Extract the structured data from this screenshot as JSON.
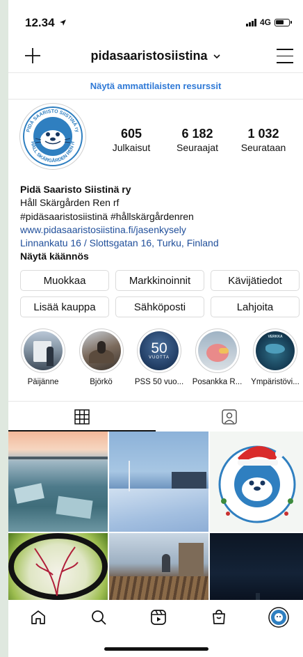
{
  "status": {
    "time": "12.34",
    "network": "4G"
  },
  "header": {
    "username": "pidasaaristosiistina",
    "pro_link": "Näytä ammattilaisten resurssit"
  },
  "profile": {
    "avatar_logo_text_top": "PIDÄ SAARISTO SIISTINÄ ry",
    "avatar_logo_text_bottom": "HÅLL SKÄRGÅRDEN REN rf",
    "stats": [
      {
        "value": "605",
        "label": "Julkaisut"
      },
      {
        "value": "6 182",
        "label": "Seuraajat"
      },
      {
        "value": "1 032",
        "label": "Seurataan"
      }
    ],
    "name": "Pidä Saaristo Siistinä ry",
    "bio_lines": [
      "Håll Skärgården Ren rf",
      "#pidäsaaristosiistinä #hållskärgårdenren"
    ],
    "website": "www.pidasaaristosiistina.fi/jasenkysely",
    "address": "Linnankatu 16 / Slottsgatan 16, Turku, Finland",
    "translate": "Näytä käännös"
  },
  "buttons": [
    "Muokkaa",
    "Markkinoinnit",
    "Kävijätiedot",
    "Lisää kauppa",
    "Sähköposti",
    "Lahjoita"
  ],
  "highlights": [
    {
      "label": "Päijänne"
    },
    {
      "label": "Björkö"
    },
    {
      "label": "PSS 50 vuo...",
      "badge": "50",
      "sub": "VUOTTA"
    },
    {
      "label": "Posankka R..."
    },
    {
      "label": "Ympäristövi...",
      "badge": "VERKKA"
    }
  ],
  "tabs": {
    "active": "grid-icon",
    "other": "tagged-icon"
  },
  "colors": {
    "link": "#2f79d6",
    "bio_link": "#1f4e9a",
    "logo_blue": "#2f7fc0"
  },
  "nav": [
    "home-icon",
    "search-icon",
    "reels-icon",
    "shop-icon",
    "profile-avatar"
  ]
}
